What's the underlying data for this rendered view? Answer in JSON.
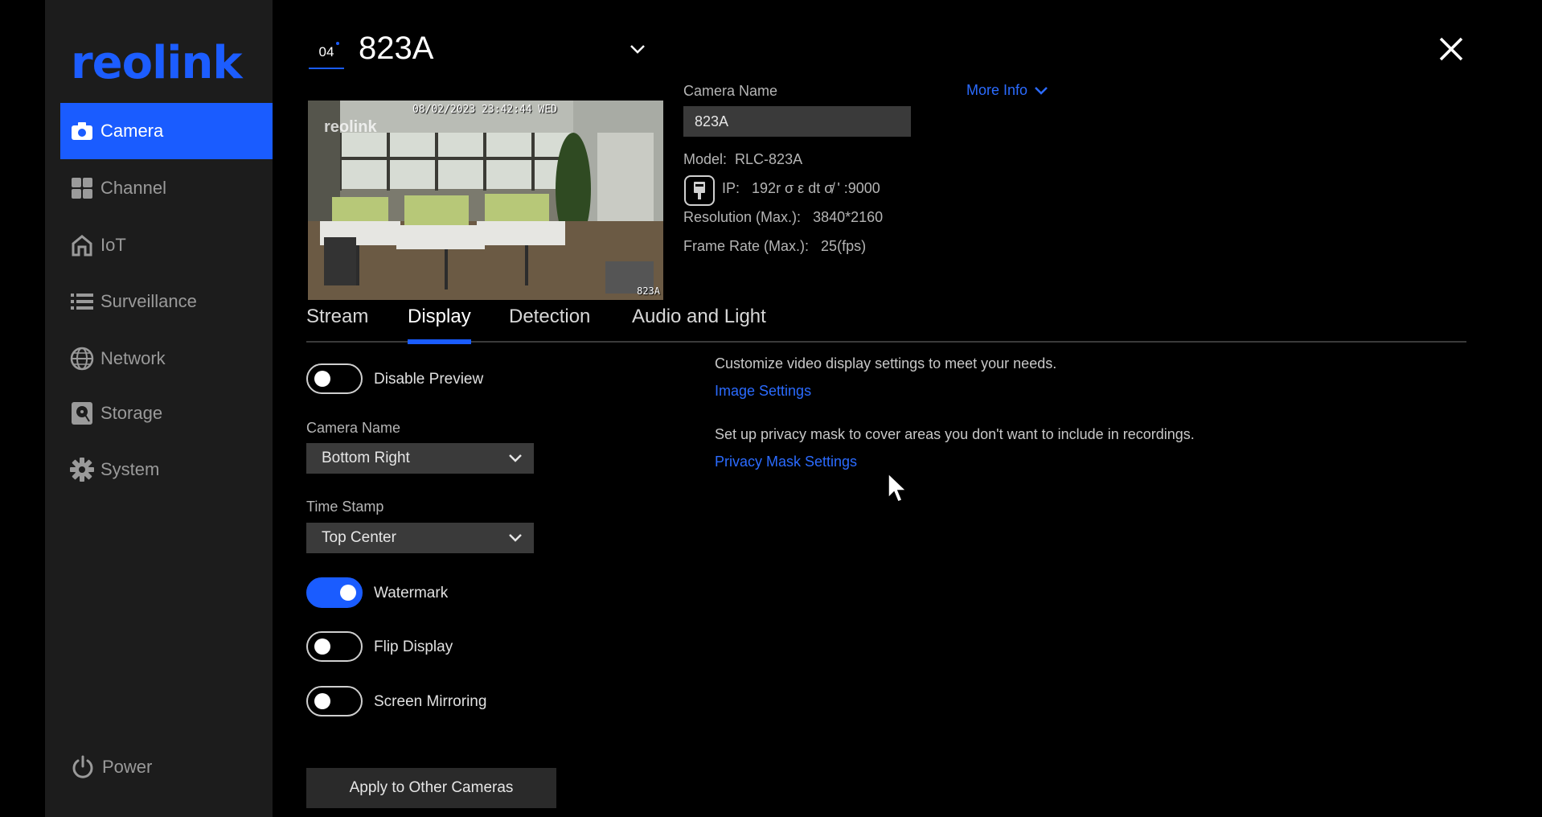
{
  "sidebar": {
    "logo": "reolink",
    "items": [
      {
        "label": "Camera",
        "icon": "camera-icon",
        "active": true
      },
      {
        "label": "Channel",
        "icon": "grid-icon"
      },
      {
        "label": "IoT",
        "icon": "home-icon"
      },
      {
        "label": "Surveillance",
        "icon": "list-icon"
      },
      {
        "label": "Network",
        "icon": "globe-icon"
      },
      {
        "label": "Storage",
        "icon": "storage-icon"
      },
      {
        "label": "System",
        "icon": "gear-icon"
      }
    ],
    "power_label": "Power"
  },
  "header": {
    "channel_number": "04",
    "camera_title": "823A"
  },
  "preview": {
    "osd_time": "08/02/2023 23:42:44 WED",
    "osd_logo": "reolink",
    "osd_name": "823A"
  },
  "info": {
    "camera_name_label": "Camera Name",
    "camera_name_value": "823A",
    "more_info": "More Info",
    "model_label": "Model:",
    "model_value": "RLC-823A",
    "ip_label": "IP:",
    "ip_value": "192r σ ε dt σ̸ ' ",
    "ip_port": ":9000",
    "resolution_label": "Resolution (Max.):",
    "resolution_value": "3840*2160",
    "framerate_label": "Frame Rate (Max.):",
    "framerate_value": "25(fps)"
  },
  "tabs": [
    "Stream",
    "Display",
    "Detection",
    "Audio and Light"
  ],
  "active_tab": "Display",
  "display": {
    "disable_preview": {
      "label": "Disable Preview",
      "on": false
    },
    "camera_name_label": "Camera Name",
    "camera_name_position": "Bottom Right",
    "time_stamp_label": "Time Stamp",
    "time_stamp_position": "Top Center",
    "watermark": {
      "label": "Watermark",
      "on": true
    },
    "flip_display": {
      "label": "Flip Display",
      "on": false
    },
    "screen_mirroring": {
      "label": "Screen Mirroring",
      "on": false
    },
    "image_desc": "Customize video display settings to meet your needs.",
    "image_link": "Image Settings",
    "privacy_desc": "Set up privacy mask to cover areas you don't want to include in recordings.",
    "privacy_link": "Privacy Mask Settings",
    "apply_label": "Apply to Other Cameras"
  },
  "colors": {
    "accent": "#1a5cff",
    "link": "#2b6bff",
    "sidebar_bg": "#1c1c1c",
    "field_bg": "#3a3a3a"
  }
}
